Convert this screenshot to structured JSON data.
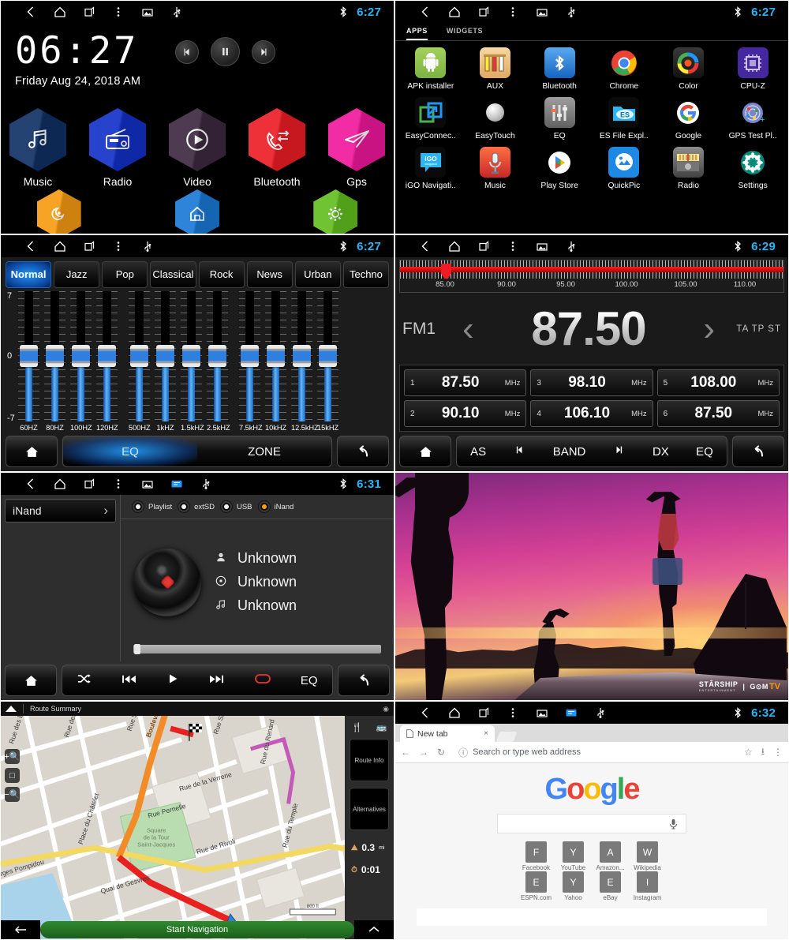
{
  "statusbar": {
    "icons": [
      "back-icon",
      "home-icon",
      "recents-icon",
      "overflow-icon",
      "screenshot-icon",
      "usb-icon"
    ],
    "bluetooth": "bluetooth-icon",
    "times": {
      "home": "6:27",
      "apps": "6:27",
      "eq": "6:27",
      "radio": "6:29",
      "music": "6:31",
      "browser": "6:32"
    }
  },
  "home": {
    "clock": "06:27",
    "date": "Friday Aug 24, 2018 AM",
    "media_controls": [
      {
        "name": "previous-track-button",
        "glyph": "❘◀"
      },
      {
        "name": "play-pause-button",
        "glyph": "❙❙"
      },
      {
        "name": "next-track-button",
        "glyph": "▶❘"
      }
    ],
    "tiles": [
      {
        "label": "Music",
        "icon": "music-note-icon",
        "color": "#0f2f63",
        "glyph": "♫"
      },
      {
        "label": "Radio",
        "icon": "radio-icon",
        "color": "#1230c8",
        "glyph": "὏B"
      },
      {
        "label": "Video",
        "icon": "play-circle-icon",
        "color": "#3d2840",
        "glyph": "▶"
      },
      {
        "label": "Bluetooth",
        "icon": "phone-call-icon",
        "color": "#ec1c24",
        "glyph": "☎"
      },
      {
        "label": "Gps",
        "icon": "navigation-arrow-icon",
        "color": "#f0179b",
        "glyph": "➤"
      }
    ],
    "tiles_row2": [
      {
        "label": "",
        "icon": "moon-icon",
        "color": "#f59a11",
        "glyph": "☾"
      },
      {
        "label": "",
        "icon": "house-icon",
        "color": "#1878d4",
        "glyph": "⌂"
      },
      {
        "label": "",
        "icon": "settings-gear-icon",
        "color": "#62bd1f",
        "glyph": "⚙"
      }
    ]
  },
  "apps": {
    "tabs": [
      {
        "label": "APPS",
        "selected": true
      },
      {
        "label": "WIDGETS",
        "selected": false
      }
    ],
    "items": [
      {
        "label": "APK installer",
        "icon": "android-robot-icon",
        "bg": "#8bc34a",
        "glyph": "▣"
      },
      {
        "label": "AUX",
        "icon": "rca-cable-icon",
        "bg": "#f0c27b",
        "glyph": "‖"
      },
      {
        "label": "Bluetooth",
        "icon": "bluetooth-icon",
        "bg": "#1e88e5",
        "glyph": "ᛦ"
      },
      {
        "label": "Chrome",
        "icon": "chrome-icon",
        "bg": "#ffffff",
        "glyph": "●"
      },
      {
        "label": "Color",
        "icon": "color-wheel-icon",
        "bg": "#2b2b2b",
        "glyph": "◉"
      },
      {
        "label": "CPU-Z",
        "icon": "cpu-chip-icon",
        "bg": "#4527a0",
        "glyph": "▦"
      },
      {
        "label": "EasyConnec..",
        "icon": "easyconnect-icon",
        "bg": "#0d0d0d",
        "glyph": "⬚"
      },
      {
        "label": "EasyTouch",
        "icon": "touch-ball-icon",
        "bg": "#000000",
        "glyph": "●"
      },
      {
        "label": "EQ",
        "icon": "equalizer-icon",
        "bg": "#757575",
        "glyph": "≡"
      },
      {
        "label": "ES File Expl..",
        "icon": "file-folder-icon",
        "bg": "#1e88e5",
        "glyph": "ES"
      },
      {
        "label": "Google",
        "icon": "google-g-icon",
        "bg": "#ffffff",
        "glyph": "G"
      },
      {
        "label": "GPS Test Pl..",
        "icon": "gps-satellite-icon",
        "bg": "#3949ab",
        "glyph": "◎"
      },
      {
        "label": "iGO Navigati..",
        "icon": "igo-navigation-icon",
        "bg": "#1e88e5",
        "glyph": "iGO"
      },
      {
        "label": "Music",
        "icon": "microphone-icon",
        "bg": "#e53935",
        "glyph": "Ἲ4"
      },
      {
        "label": "Play Store",
        "icon": "play-store-icon",
        "bg": "#ffffff",
        "glyph": "▶"
      },
      {
        "label": "QuickPic",
        "icon": "gallery-photo-icon",
        "bg": "#1e88e5",
        "glyph": "◰"
      },
      {
        "label": "Radio",
        "icon": "radio-tuner-icon",
        "bg": "#616161",
        "glyph": "▭"
      },
      {
        "label": "Settings",
        "icon": "settings-gear-icon",
        "bg": "#00897b",
        "glyph": "⚙"
      }
    ]
  },
  "eq": {
    "presets": [
      "Normal",
      "Jazz",
      "Pop",
      "Classical",
      "Rock",
      "News",
      "Urban",
      "Techno"
    ],
    "selected_preset": "Normal",
    "scale": {
      "max": "7",
      "mid": "0",
      "min": "-7"
    },
    "bands": [
      "60HZ",
      "80HZ",
      "100HZ",
      "120HZ",
      "500HZ",
      "1kHZ",
      "1.5kHZ",
      "2.5kHZ",
      "7.5kHZ",
      "10kHZ",
      "12.5kHZ",
      "15kHZ"
    ],
    "band_values": [
      0,
      0,
      0,
      0,
      0,
      0,
      0,
      0,
      0,
      0,
      0,
      0
    ],
    "bottom": {
      "home": "home-icon",
      "eq_label": "EQ",
      "zone_label": "ZONE",
      "back": "back-arrow-icon"
    }
  },
  "radio": {
    "band": "FM1",
    "frequency": "87.50",
    "scale_ticks": [
      "85.00",
      "90.00",
      "95.00",
      "100.00",
      "105.00",
      "110.00"
    ],
    "indicators": "TA TP ST",
    "presets": [
      {
        "no": "1",
        "freq": "87.50",
        "unit": "MHz"
      },
      {
        "no": "3",
        "freq": "98.10",
        "unit": "MHz"
      },
      {
        "no": "5",
        "freq": "108.00",
        "unit": "MHz"
      },
      {
        "no": "2",
        "freq": "90.10",
        "unit": "MHz"
      },
      {
        "no": "4",
        "freq": "106.10",
        "unit": "MHz"
      },
      {
        "no": "6",
        "freq": "87.50",
        "unit": "MHz"
      }
    ],
    "toolbar": [
      "AS",
      "❘◀",
      "BAND",
      "▶❘",
      "DX",
      "EQ"
    ],
    "home": "home-icon",
    "back": "back-arrow-icon"
  },
  "music": {
    "source_button": "iNand",
    "sources": [
      {
        "label": "Playlist",
        "selected": false
      },
      {
        "label": "extSD",
        "selected": false
      },
      {
        "label": "USB",
        "selected": false
      },
      {
        "label": "iNand",
        "selected": true
      }
    ],
    "meta": [
      {
        "icon": "artist-icon",
        "glyph": "●",
        "value": "Unknown"
      },
      {
        "icon": "album-icon",
        "glyph": "◎",
        "value": "Unknown"
      },
      {
        "icon": "track-icon",
        "glyph": "♫",
        "value": "Unknown"
      }
    ],
    "toolbar": [
      {
        "name": "shuffle-button",
        "glyph": "⤨"
      },
      {
        "name": "previous-button",
        "glyph": "⏮"
      },
      {
        "name": "play-button",
        "glyph": "▶"
      },
      {
        "name": "next-button",
        "glyph": "⏭"
      },
      {
        "name": "repeat-button",
        "glyph": "↻"
      },
      {
        "name": "eq-button",
        "glyph": "EQ"
      }
    ],
    "home": "home-icon",
    "back": "back-arrow-icon"
  },
  "video": {
    "watermark_left": "STÂRSHIP",
    "watermark_sub": "ENTERTAINMENT",
    "watermark_divider": "|",
    "watermark_right": "G⊙M",
    "watermark_right2": "TV"
  },
  "map": {
    "title": "Route Summary",
    "streets": [
      "Rue des Bourdo",
      "Rue des Halles",
      "Rue Saint",
      "Boulevard de Sébastopol",
      "Rue Saint-Mar",
      "Rue de la Verrerie",
      "Rue Pernelle",
      "Rue du Renard",
      "Rue de Rivoli",
      "Rue du Temple",
      "Square de la Tour Saint-Jacques",
      "Place du Châtelet",
      "Quai de Gesvres",
      "rges Pompidou"
    ],
    "sidebar": {
      "buttons": [
        "Route Info",
        "Alternatives"
      ],
      "distance": "0.3",
      "distance_unit": "mi",
      "time": "0:01",
      "icons": [
        "restaurant-icon",
        "bus-icon",
        "distance-icon",
        "clock-icon"
      ]
    },
    "scale_label": "800 ft",
    "start_button": "Start Navigation",
    "back_icon": "back-arrow-icon",
    "expand_icon": "chevron-up-icon"
  },
  "browser": {
    "tab_title": "New tab",
    "tab_close": "×",
    "omnibox_placeholder": "Search or type web address",
    "nav_icons": [
      "back-arrow-icon",
      "forward-arrow-icon",
      "reload-icon",
      "info-icon",
      "bookmark-star-icon",
      "download-icon",
      "menu-overflow-icon"
    ],
    "logo": "Google",
    "logo_letters": [
      {
        "ch": "G",
        "color": "#4285f4"
      },
      {
        "ch": "o",
        "color": "#ea4335"
      },
      {
        "ch": "o",
        "color": "#fbbc05"
      },
      {
        "ch": "g",
        "color": "#4285f4"
      },
      {
        "ch": "l",
        "color": "#34a853"
      },
      {
        "ch": "e",
        "color": "#ea4335"
      }
    ],
    "mic_icon": "microphone-icon",
    "shortcuts": [
      {
        "letter": "F",
        "label": "Facebook"
      },
      {
        "letter": "Y",
        "label": "YouTube"
      },
      {
        "letter": "A",
        "label": "Amazon..."
      },
      {
        "letter": "W",
        "label": "Wikipedia"
      },
      {
        "letter": "E",
        "label": "ESPN.com"
      },
      {
        "letter": "Y",
        "label": "Yahoo"
      },
      {
        "letter": "E",
        "label": "eBay"
      },
      {
        "letter": "I",
        "label": "Instagram"
      }
    ]
  }
}
